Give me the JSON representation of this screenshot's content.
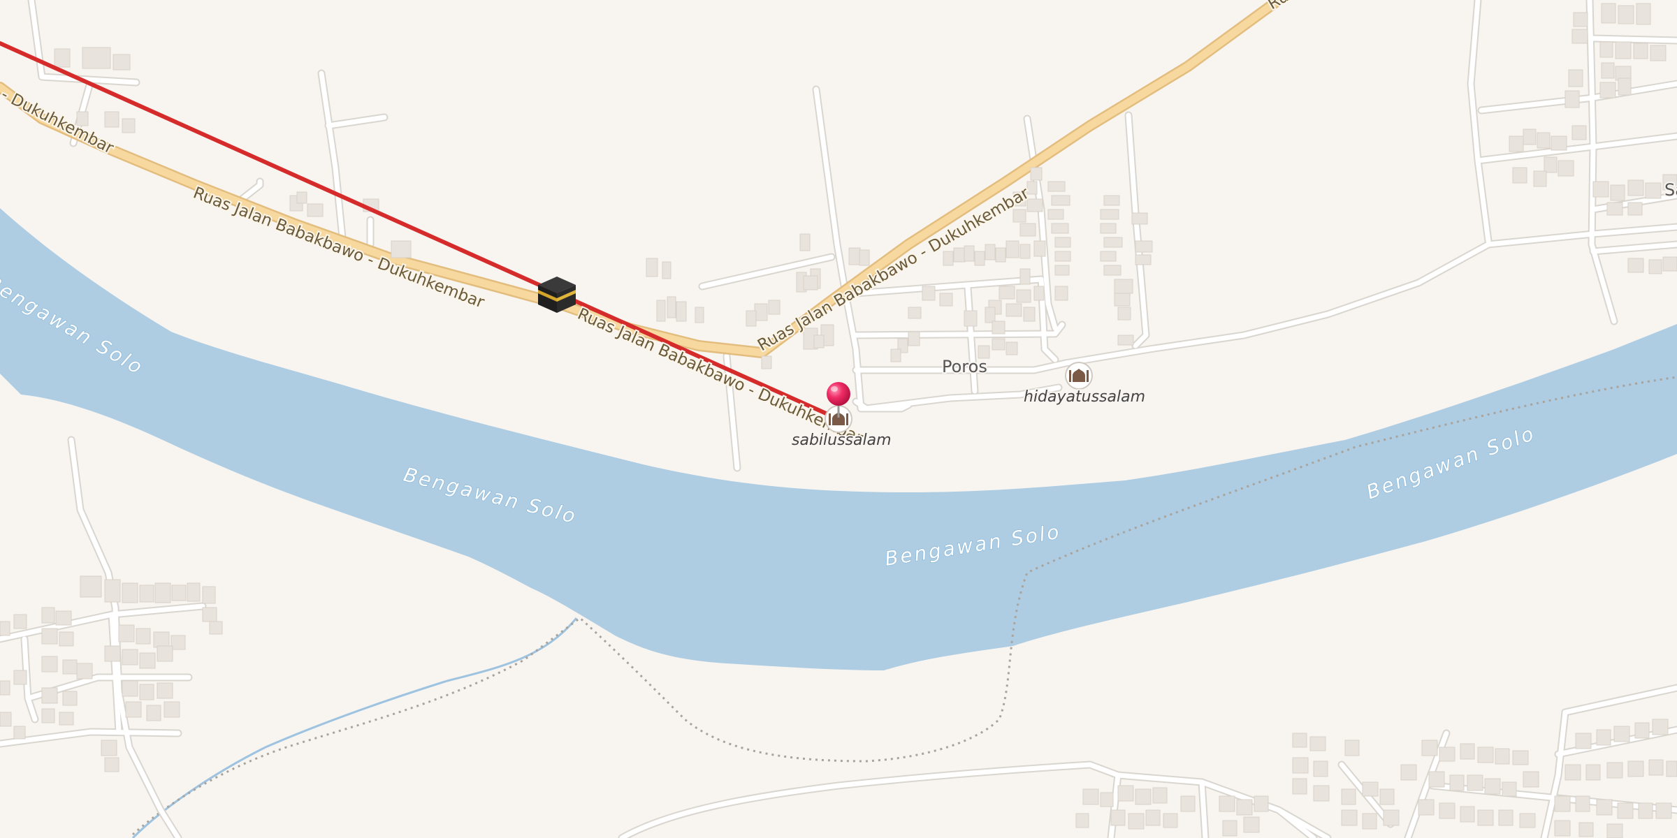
{
  "map": {
    "colors": {
      "land": "#f8f5f1",
      "water": "#aecde3",
      "main_road": "#f7d9a0",
      "main_road_casing": "#e3bd7e",
      "minor_road": "#ffffff",
      "minor_road_casing": "#dcd8d2",
      "building": "#e8e3dc",
      "building_outline": "#d8d1c7",
      "qibla_line": "#d62b2b",
      "pin": "#e8205a",
      "boundary": "#a9a39b"
    },
    "roads": [
      {
        "name": "Ruas Jalan Babakbawo - Dukuhkembar"
      }
    ],
    "road_labels": [
      "- Dukuhkembar",
      "Ruas Jalan Babakbawo - Dukuhkembar",
      "Ruas Jalan Babakbawo - Dukuhkembar",
      "Ruas Jalan Babakbawo - Dukuhkembar",
      "Ru"
    ],
    "river": {
      "name": "Bengawan Solo",
      "labels": [
        "Bengawan Solo",
        "Bengawan Solo",
        "Bengawan Solo",
        "Bengawan Solo"
      ]
    },
    "places": [
      {
        "name": "Poros",
        "kind": "village"
      },
      {
        "name": "Sa",
        "kind": "village"
      }
    ],
    "pois": [
      {
        "name": "sabilussalam",
        "icon": "mosque-icon",
        "selected": true
      },
      {
        "name": "hidayatussalam",
        "icon": "mosque-icon",
        "selected": false
      }
    ],
    "markers": {
      "kaaba": {
        "icon": "kaaba-icon"
      },
      "pin": {
        "icon": "map-pin-icon"
      }
    },
    "qibla_line": {
      "icon": "qibla-direction-line"
    }
  }
}
